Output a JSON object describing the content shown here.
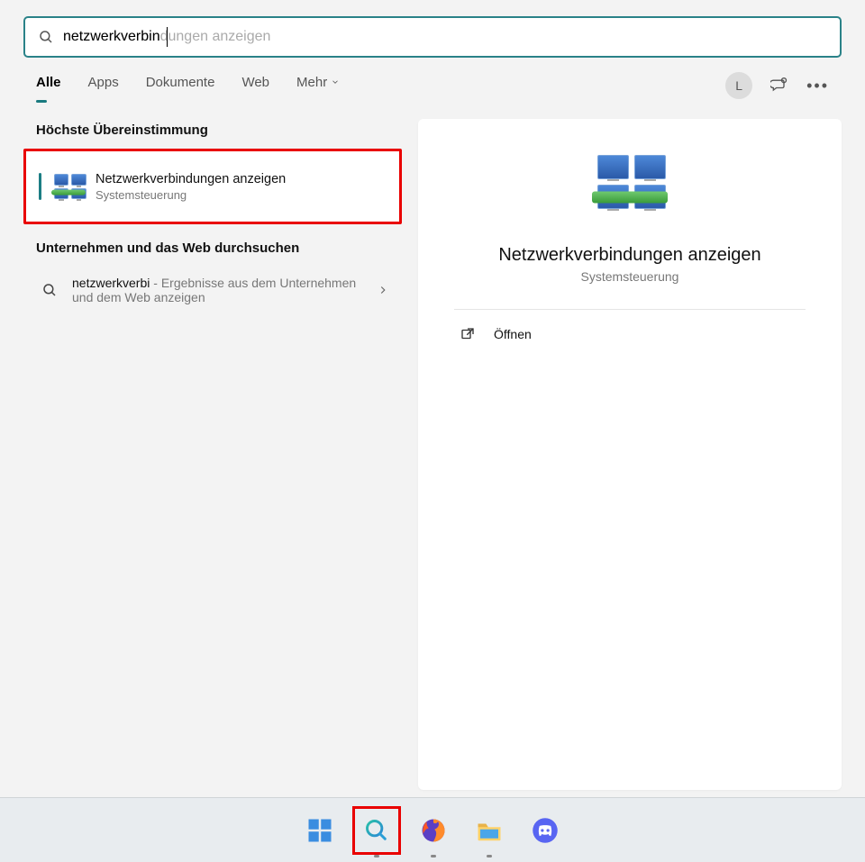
{
  "search": {
    "typed": "netzwerkverbin",
    "ghost": "netzwerkverbindungen anzeigen"
  },
  "tabs": {
    "items": [
      "Alle",
      "Apps",
      "Dokumente",
      "Web"
    ],
    "more": "Mehr"
  },
  "user": {
    "initial": "L"
  },
  "sections": {
    "best_match_header": "Höchste Übereinstimmung",
    "web_header": "Unternehmen und das Web durchsuchen"
  },
  "best_match": {
    "title": "Netzwerkverbindungen anzeigen",
    "subtitle": "Systemsteuerung"
  },
  "web_result": {
    "query": "netzwerkverbi",
    "suffix": " - Ergebnisse aus dem Unternehmen und dem Web anzeigen"
  },
  "detail": {
    "title": "Netzwerkverbindungen anzeigen",
    "subtitle": "Systemsteuerung",
    "open": "Öffnen"
  },
  "taskbar": {
    "items": [
      "start",
      "search",
      "firefox",
      "explorer",
      "discord"
    ]
  }
}
